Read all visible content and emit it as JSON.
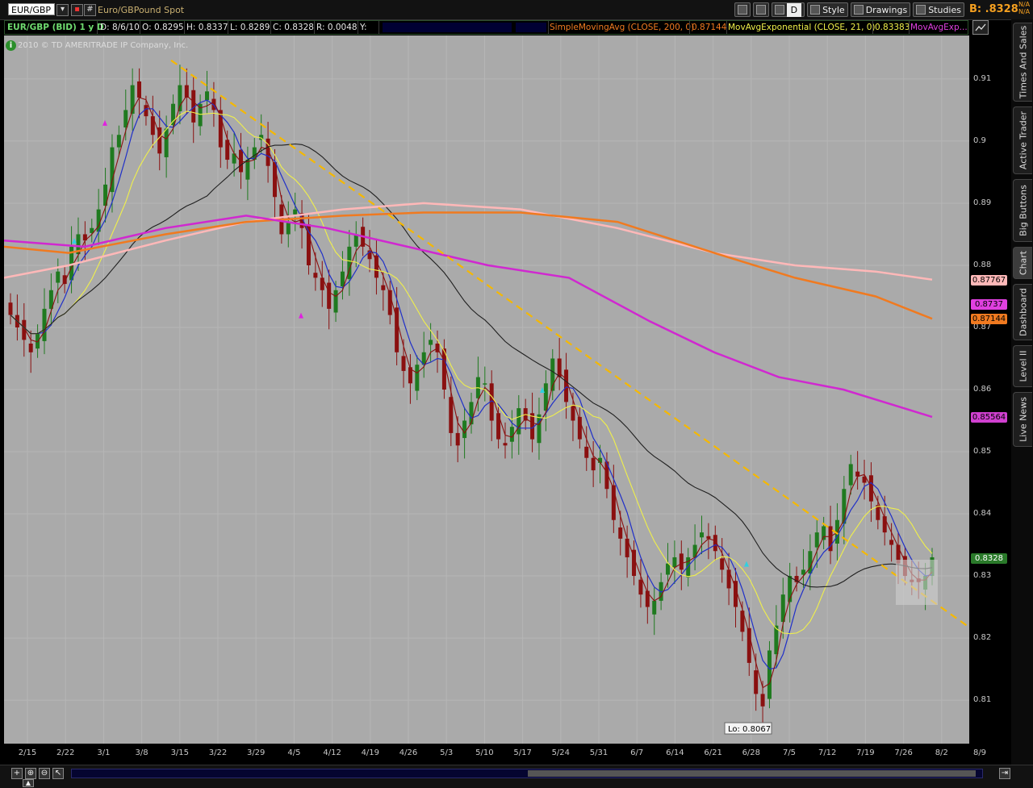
{
  "toolbar": {
    "symbol": "EUR/GBP",
    "description": "Euro/GBPound Spot",
    "period_button": "D",
    "style_label": "Style",
    "drawings_label": "Drawings",
    "studies_label": "Studies",
    "bid_label": "B: .8328",
    "na_top": "N/A",
    "na_bottom": "N/A"
  },
  "status": {
    "symbol_label": "EUR/GBP (BID) 1 y D",
    "date": "D: 8/6/10",
    "open": "O: 0.8295",
    "high": "H: 0.8337",
    "low": "L: 0.8289",
    "close": "C: 0.8328",
    "range": "R: 0.0048",
    "y": "Y:",
    "sma_label": "SimpleMovingAvg (CLOSE, 200, 0)",
    "sma_value": "0.87144",
    "ema_label": "MovAvgExponential (CLOSE, 21, 0)",
    "ema_value": "0.83383",
    "movavg_label": "MovAvgExp..."
  },
  "chart": {
    "copyright": "2010 © TD AMERITRADE IP Company, Inc.",
    "lo_label": "Lo: 0.8067",
    "price_tags": [
      {
        "value": "0.87767",
        "color": "#ffb8b8"
      },
      {
        "value": "0.8737",
        "color": "#e040e0"
      },
      {
        "value": "0.87144",
        "color": "#f07a20"
      },
      {
        "value": "0.85564",
        "color": "#d040d0"
      },
      {
        "value": "0.8328",
        "color": "#2a7a2a"
      }
    ]
  },
  "sidebar": {
    "tabs": [
      "Times And Sales",
      "Active Trader",
      "Big Buttons",
      "Chart",
      "Dashboard",
      "Level II",
      "Live News"
    ]
  },
  "chart_data": {
    "type": "candlestick",
    "title": "EUR/GBP (BID) 1 y D",
    "x_tick_labels": [
      "2/15",
      "2/22",
      "3/1",
      "3/8",
      "3/15",
      "3/22",
      "3/29",
      "4/5",
      "4/12",
      "4/19",
      "4/26",
      "5/3",
      "5/10",
      "5/17",
      "5/24",
      "5/31",
      "6/7",
      "6/14",
      "6/21",
      "6/28",
      "7/5",
      "7/12",
      "7/19",
      "7/26",
      "8/2",
      "8/9"
    ],
    "y_tick_labels": [
      "0.81",
      "0.82",
      "0.83",
      "0.84",
      "0.85",
      "0.86",
      "0.87",
      "0.88",
      "0.89",
      "0.9",
      "0.91"
    ],
    "ylim": [
      0.803,
      0.917
    ],
    "series": [
      {
        "name": "EUR/GBP close",
        "type": "candlestick",
        "close": [
          0.872,
          0.87,
          0.868,
          0.866,
          0.869,
          0.873,
          0.876,
          0.879,
          0.877,
          0.883,
          0.885,
          0.884,
          0.886,
          0.889,
          0.893,
          0.899,
          0.901,
          0.905,
          0.909,
          0.907,
          0.904,
          0.901,
          0.898,
          0.902,
          0.906,
          0.909,
          0.907,
          0.903,
          0.906,
          0.908,
          0.905,
          0.899,
          0.897,
          0.898,
          0.895,
          0.897,
          0.899,
          0.901,
          0.896,
          0.891,
          0.885,
          0.887,
          0.889,
          0.886,
          0.88,
          0.878,
          0.876,
          0.873,
          0.876,
          0.879,
          0.883,
          0.885,
          0.883,
          0.881,
          0.878,
          0.876,
          0.872,
          0.866,
          0.863,
          0.861,
          0.864,
          0.866,
          0.868,
          0.866,
          0.86,
          0.853,
          0.851,
          0.855,
          0.858,
          0.862,
          0.861,
          0.855,
          0.852,
          0.851,
          0.854,
          0.857,
          0.855,
          0.852,
          0.856,
          0.861,
          0.865,
          0.862,
          0.858,
          0.855,
          0.852,
          0.849,
          0.847,
          0.849,
          0.844,
          0.839,
          0.836,
          0.833,
          0.83,
          0.827,
          0.825,
          0.826,
          0.829,
          0.832,
          0.833,
          0.831,
          0.833,
          0.835,
          0.837,
          0.836,
          0.834,
          0.831,
          0.828,
          0.825,
          0.821,
          0.816,
          0.811,
          0.809,
          0.818,
          0.822,
          0.827,
          0.83,
          0.829,
          0.831,
          0.834,
          0.837,
          0.838,
          0.834,
          0.839,
          0.844,
          0.848,
          0.846,
          0.845,
          0.842,
          0.839,
          0.837,
          0.835,
          0.832,
          0.83,
          0.829,
          0.829,
          0.83,
          0.833
        ]
      },
      {
        "name": "SimpleMovingAvg (CLOSE, 200, 0)",
        "type": "line",
        "last": 0.87144
      },
      {
        "name": "MovAvgExponential (CLOSE, 21, 0)",
        "type": "line",
        "last": 0.83383
      }
    ],
    "annotations": [
      {
        "text": "Lo: 0.8067",
        "x": "6/30",
        "y": 0.8067
      }
    ],
    "trendline": {
      "from": [
        "3/15",
        0.913
      ],
      "to": [
        "8/10",
        0.822
      ],
      "style": "dashed",
      "color": "#f5b800"
    }
  }
}
